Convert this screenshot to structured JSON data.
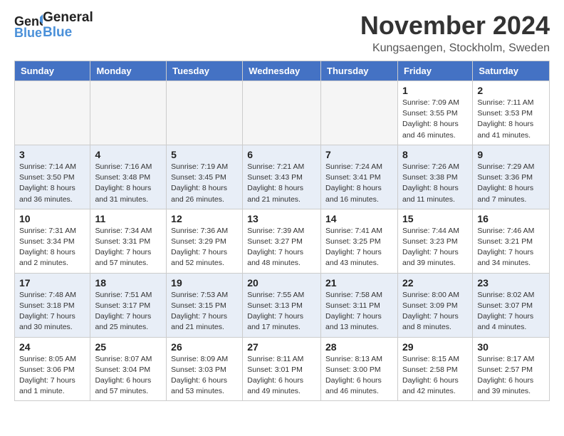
{
  "logo": {
    "general": "General",
    "blue": "Blue"
  },
  "header": {
    "title": "November 2024",
    "location": "Kungsaengen, Stockholm, Sweden"
  },
  "weekdays": [
    "Sunday",
    "Monday",
    "Tuesday",
    "Wednesday",
    "Thursday",
    "Friday",
    "Saturday"
  ],
  "weeks": [
    [
      {
        "day": "",
        "info": ""
      },
      {
        "day": "",
        "info": ""
      },
      {
        "day": "",
        "info": ""
      },
      {
        "day": "",
        "info": ""
      },
      {
        "day": "",
        "info": ""
      },
      {
        "day": "1",
        "info": "Sunrise: 7:09 AM\nSunset: 3:55 PM\nDaylight: 8 hours and 46 minutes."
      },
      {
        "day": "2",
        "info": "Sunrise: 7:11 AM\nSunset: 3:53 PM\nDaylight: 8 hours and 41 minutes."
      }
    ],
    [
      {
        "day": "3",
        "info": "Sunrise: 7:14 AM\nSunset: 3:50 PM\nDaylight: 8 hours and 36 minutes."
      },
      {
        "day": "4",
        "info": "Sunrise: 7:16 AM\nSunset: 3:48 PM\nDaylight: 8 hours and 31 minutes."
      },
      {
        "day": "5",
        "info": "Sunrise: 7:19 AM\nSunset: 3:45 PM\nDaylight: 8 hours and 26 minutes."
      },
      {
        "day": "6",
        "info": "Sunrise: 7:21 AM\nSunset: 3:43 PM\nDaylight: 8 hours and 21 minutes."
      },
      {
        "day": "7",
        "info": "Sunrise: 7:24 AM\nSunset: 3:41 PM\nDaylight: 8 hours and 16 minutes."
      },
      {
        "day": "8",
        "info": "Sunrise: 7:26 AM\nSunset: 3:38 PM\nDaylight: 8 hours and 11 minutes."
      },
      {
        "day": "9",
        "info": "Sunrise: 7:29 AM\nSunset: 3:36 PM\nDaylight: 8 hours and 7 minutes."
      }
    ],
    [
      {
        "day": "10",
        "info": "Sunrise: 7:31 AM\nSunset: 3:34 PM\nDaylight: 8 hours and 2 minutes."
      },
      {
        "day": "11",
        "info": "Sunrise: 7:34 AM\nSunset: 3:31 PM\nDaylight: 7 hours and 57 minutes."
      },
      {
        "day": "12",
        "info": "Sunrise: 7:36 AM\nSunset: 3:29 PM\nDaylight: 7 hours and 52 minutes."
      },
      {
        "day": "13",
        "info": "Sunrise: 7:39 AM\nSunset: 3:27 PM\nDaylight: 7 hours and 48 minutes."
      },
      {
        "day": "14",
        "info": "Sunrise: 7:41 AM\nSunset: 3:25 PM\nDaylight: 7 hours and 43 minutes."
      },
      {
        "day": "15",
        "info": "Sunrise: 7:44 AM\nSunset: 3:23 PM\nDaylight: 7 hours and 39 minutes."
      },
      {
        "day": "16",
        "info": "Sunrise: 7:46 AM\nSunset: 3:21 PM\nDaylight: 7 hours and 34 minutes."
      }
    ],
    [
      {
        "day": "17",
        "info": "Sunrise: 7:48 AM\nSunset: 3:18 PM\nDaylight: 7 hours and 30 minutes."
      },
      {
        "day": "18",
        "info": "Sunrise: 7:51 AM\nSunset: 3:17 PM\nDaylight: 7 hours and 25 minutes."
      },
      {
        "day": "19",
        "info": "Sunrise: 7:53 AM\nSunset: 3:15 PM\nDaylight: 7 hours and 21 minutes."
      },
      {
        "day": "20",
        "info": "Sunrise: 7:55 AM\nSunset: 3:13 PM\nDaylight: 7 hours and 17 minutes."
      },
      {
        "day": "21",
        "info": "Sunrise: 7:58 AM\nSunset: 3:11 PM\nDaylight: 7 hours and 13 minutes."
      },
      {
        "day": "22",
        "info": "Sunrise: 8:00 AM\nSunset: 3:09 PM\nDaylight: 7 hours and 8 minutes."
      },
      {
        "day": "23",
        "info": "Sunrise: 8:02 AM\nSunset: 3:07 PM\nDaylight: 7 hours and 4 minutes."
      }
    ],
    [
      {
        "day": "24",
        "info": "Sunrise: 8:05 AM\nSunset: 3:06 PM\nDaylight: 7 hours and 1 minute."
      },
      {
        "day": "25",
        "info": "Sunrise: 8:07 AM\nSunset: 3:04 PM\nDaylight: 6 hours and 57 minutes."
      },
      {
        "day": "26",
        "info": "Sunrise: 8:09 AM\nSunset: 3:03 PM\nDaylight: 6 hours and 53 minutes."
      },
      {
        "day": "27",
        "info": "Sunrise: 8:11 AM\nSunset: 3:01 PM\nDaylight: 6 hours and 49 minutes."
      },
      {
        "day": "28",
        "info": "Sunrise: 8:13 AM\nSunset: 3:00 PM\nDaylight: 6 hours and 46 minutes."
      },
      {
        "day": "29",
        "info": "Sunrise: 8:15 AM\nSunset: 2:58 PM\nDaylight: 6 hours and 42 minutes."
      },
      {
        "day": "30",
        "info": "Sunrise: 8:17 AM\nSunset: 2:57 PM\nDaylight: 6 hours and 39 minutes."
      }
    ]
  ]
}
